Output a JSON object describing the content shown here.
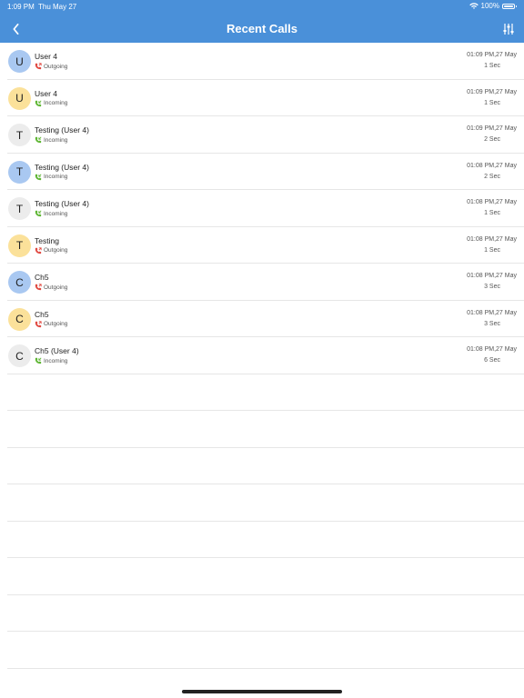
{
  "status": {
    "time": "1:09 PM",
    "date": "Thu May 27",
    "battery": "100%"
  },
  "header": {
    "title": "Recent Calls"
  },
  "colors": {
    "header": "#4a90d9",
    "blue_avatar": "#a9c8f1",
    "yellow_avatar": "#fbe19a",
    "grey_avatar": "#ececec",
    "outgoing": "#e0473f",
    "incoming": "#5cb531"
  },
  "calls": [
    {
      "initial": "U",
      "name": "User 4",
      "type": "Outgoing",
      "time": "01:09 PM,27 May",
      "duration": "1 Sec",
      "avatar": "blue"
    },
    {
      "initial": "U",
      "name": "User 4",
      "type": "Incoming",
      "time": "01:09 PM,27 May",
      "duration": "1 Sec",
      "avatar": "yellow"
    },
    {
      "initial": "T",
      "name": "Testing (User 4)",
      "type": "Incoming",
      "time": "01:09 PM,27 May",
      "duration": "2 Sec",
      "avatar": "grey"
    },
    {
      "initial": "T",
      "name": "Testing (User 4)",
      "type": "Incoming",
      "time": "01:08 PM,27 May",
      "duration": "2 Sec",
      "avatar": "blue"
    },
    {
      "initial": "T",
      "name": "Testing (User 4)",
      "type": "Incoming",
      "time": "01:08 PM,27 May",
      "duration": "1 Sec",
      "avatar": "grey"
    },
    {
      "initial": "T",
      "name": "Testing",
      "type": "Outgoing",
      "time": "01:08 PM,27 May",
      "duration": "1 Sec",
      "avatar": "yellow"
    },
    {
      "initial": "C",
      "name": "Ch5",
      "type": "Outgoing",
      "time": "01:08 PM,27 May",
      "duration": "3 Sec",
      "avatar": "blue"
    },
    {
      "initial": "C",
      "name": "Ch5",
      "type": "Outgoing",
      "time": "01:08 PM,27 May",
      "duration": "3 Sec",
      "avatar": "yellow"
    },
    {
      "initial": "C",
      "name": "Ch5 (User 4)",
      "type": "Incoming",
      "time": "01:08 PM,27 May",
      "duration": "6 Sec",
      "avatar": "grey"
    }
  ]
}
